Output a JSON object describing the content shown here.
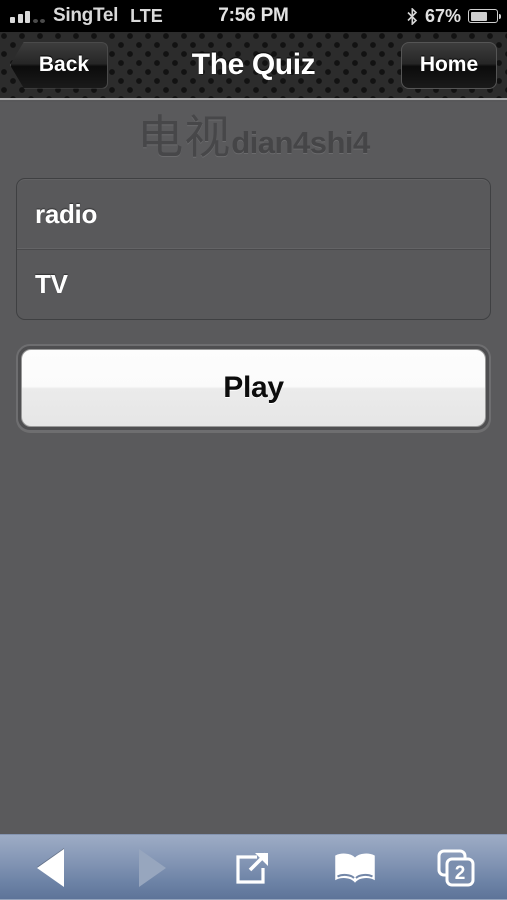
{
  "status_bar": {
    "carrier": "SingTel",
    "network": "LTE",
    "time": "7:56 PM",
    "battery_percent": "67%",
    "signal_bars_filled": 3,
    "signal_bars_empty": 2,
    "bluetooth_icon": "bluetooth-icon",
    "battery_icon": "battery-icon",
    "battery_level": 0.67
  },
  "nav_bar": {
    "back_label": "Back",
    "title": "The Quiz",
    "home_label": "Home"
  },
  "quiz": {
    "question_hanzi": "电视",
    "question_pinyin": "dian4shi4",
    "options": [
      {
        "label": "radio"
      },
      {
        "label": "TV"
      }
    ],
    "play_label": "Play"
  },
  "toolbar": {
    "items": [
      {
        "name": "back-arrow-icon",
        "label": "",
        "state": "enabled"
      },
      {
        "name": "forward-arrow-icon",
        "label": "",
        "state": "disabled"
      },
      {
        "name": "share-icon",
        "label": "",
        "state": "enabled"
      },
      {
        "name": "bookmarks-book-icon",
        "label": "",
        "state": "enabled"
      },
      {
        "name": "tabs-icon",
        "label": "2",
        "state": "enabled"
      }
    ],
    "tab_count": "2"
  },
  "colors": {
    "page_background": "#5a5a5c",
    "navbar_background": "#2c2c2c",
    "toolbar_top": "#9dacc5",
    "toolbar_bottom": "#5d7398",
    "option_panel": "#59595b",
    "play_button": "#fbfbfb"
  }
}
